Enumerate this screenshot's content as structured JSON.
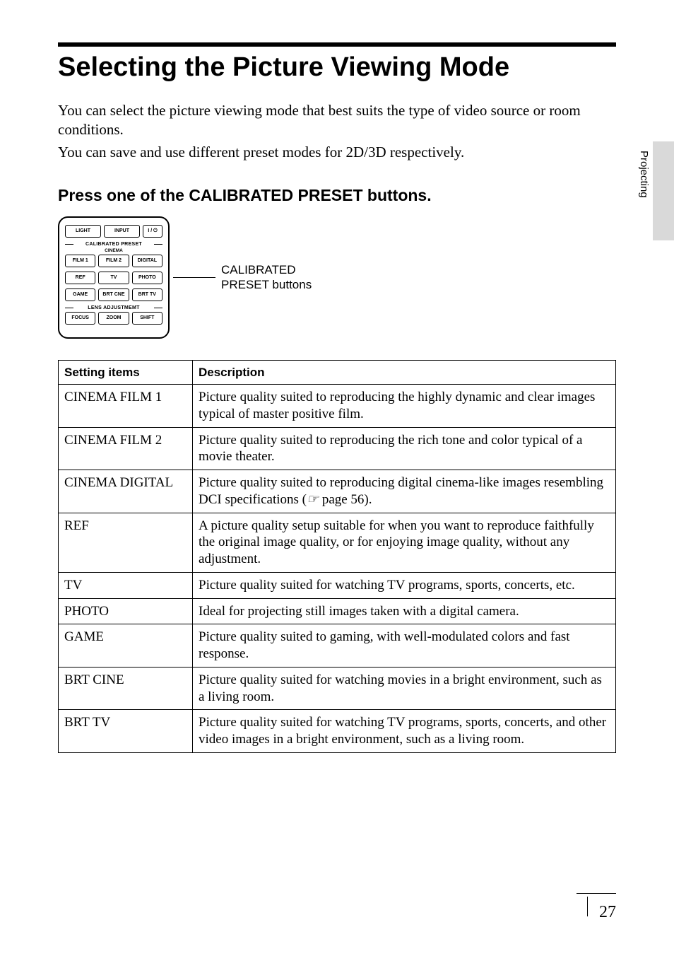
{
  "title": "Selecting the Picture Viewing Mode",
  "intro_line1": "You can select the picture viewing mode that best suits the type of video source or room conditions.",
  "intro_line2": "You can save and use different preset modes for 2D/3D respectively.",
  "subhead": "Press one of the CALIBRATED PRESET buttons.",
  "side_tab": "Projecting",
  "callout": {
    "line1": "CALIBRATED",
    "line2": "PRESET buttons"
  },
  "remote": {
    "row1": [
      "LIGHT",
      "INPUT",
      "I / ⏻"
    ],
    "group1_label": "CALIBRATED PRESET",
    "cinema_label": "CINEMA",
    "row2": [
      "FILM 1",
      "FILM 2",
      "DIGITAL"
    ],
    "row3": [
      "REF",
      "TV",
      "PHOTO"
    ],
    "row4": [
      "GAME",
      "BRT CNE",
      "BRT TV"
    ],
    "group2_label": "LENS ADJUSTMEMT",
    "row5": [
      "FOCUS",
      "ZOOM",
      "SHIFT"
    ]
  },
  "table": {
    "headers": [
      "Setting items",
      "Description"
    ],
    "rows": [
      {
        "item": "CINEMA FILM 1",
        "desc": "Picture quality suited to reproducing the highly dynamic and clear images typical of master positive film."
      },
      {
        "item": "CINEMA FILM 2",
        "desc": "Picture quality suited to reproducing the rich tone and color typical of a movie theater."
      },
      {
        "item": "CINEMA DIGITAL",
        "desc_pre": "Picture quality suited to reproducing digital cinema-like images resembling DCI specifications (",
        "page_ref_icon": "☞",
        "page_ref": " page 56).",
        "desc_post": ""
      },
      {
        "item": "REF",
        "desc": "A picture quality setup suitable for when you want to reproduce faithfully the original image quality, or for enjoying image quality, without any adjustment."
      },
      {
        "item": "TV",
        "desc": "Picture quality suited for watching TV programs, sports, concerts, etc."
      },
      {
        "item": "PHOTO",
        "desc": "Ideal for projecting still images taken with a digital camera."
      },
      {
        "item": "GAME",
        "desc": "Picture quality suited to gaming, with well-modulated colors and fast response."
      },
      {
        "item": "BRT CINE",
        "desc": "Picture quality suited for watching movies in a bright environment, such as a living room."
      },
      {
        "item": "BRT TV",
        "desc": "Picture quality suited for watching TV programs, sports, concerts, and other video images in a bright environment, such as a living room."
      }
    ]
  },
  "page_number": "27"
}
